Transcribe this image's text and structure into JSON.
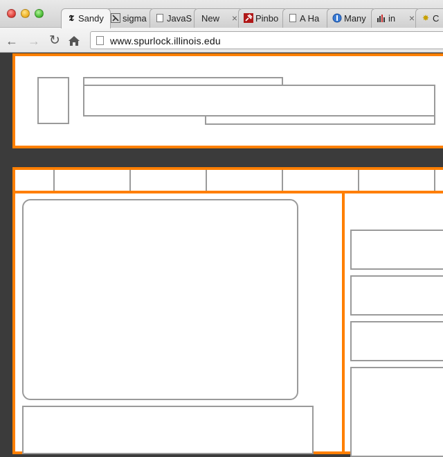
{
  "browser": {
    "tabs": [
      {
        "title": "Sandy",
        "icon": "nyt-logo-icon"
      },
      {
        "title": "sigma",
        "icon": "sigma-favicon-icon"
      },
      {
        "title": "JavaS",
        "icon": "document-icon"
      },
      {
        "title": "New",
        "icon": "",
        "close": "×"
      },
      {
        "title": "Pinbo",
        "icon": "pinboard-pin-icon"
      },
      {
        "title": "A Ha",
        "icon": "document-icon"
      },
      {
        "title": "Many",
        "icon": "globe-icon"
      },
      {
        "title": "in",
        "icon": "bar-chart-icon",
        "close": "×"
      },
      {
        "title": "C",
        "icon": "puzzle-icon"
      }
    ],
    "url": "www.spurlock.illinois.edu"
  },
  "colors": {
    "accent": "#ff7f00",
    "page_background": "#3b3b3b",
    "wire_border": "#9a9a9a"
  },
  "nav_segments": 6
}
